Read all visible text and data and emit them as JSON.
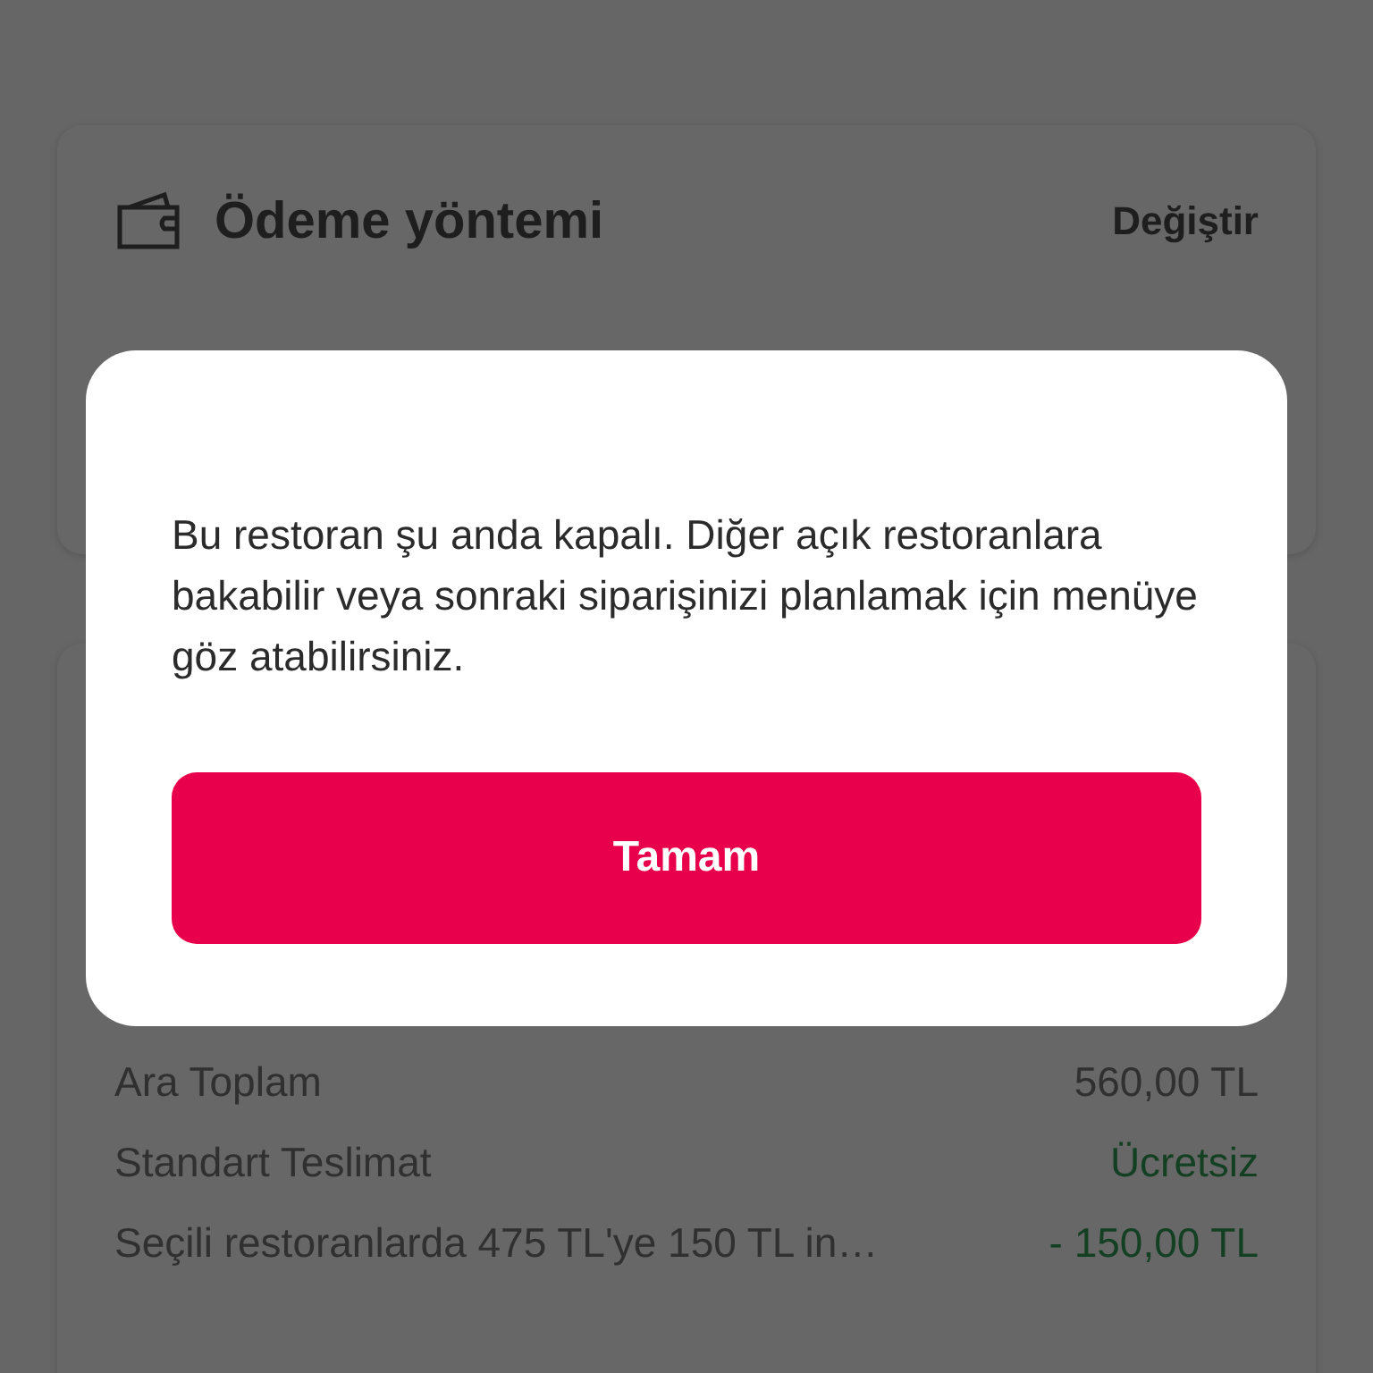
{
  "payment_card": {
    "title": "Ödeme yöntemi",
    "action": "Değiştir"
  },
  "summary": {
    "rows": [
      {
        "label": "Ara Toplam",
        "value": "560,00 TL",
        "kind": "amount"
      },
      {
        "label": "Standart Teslimat",
        "value": "Ücretsiz",
        "kind": "credit"
      },
      {
        "label": "Seçili restoranlarda 475 TL'ye 150 TL in…",
        "value": "- 150,00 TL",
        "kind": "credit"
      }
    ]
  },
  "dialog": {
    "message": "Bu restoran şu anda kapalı. Diğer açık restoranlara bakabilir veya sonraki siparişinizi planlamak için menüye göz atabilirsiniz.",
    "button": "Tamam"
  }
}
